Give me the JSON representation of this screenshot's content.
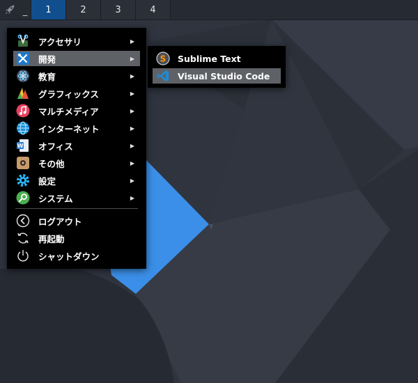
{
  "panel": {
    "launcher_icon": "rocket-icon",
    "separator": "_",
    "workspaces": [
      {
        "label": "1",
        "active": true
      },
      {
        "label": "2",
        "active": false
      },
      {
        "label": "3",
        "active": false
      },
      {
        "label": "4",
        "active": false
      }
    ]
  },
  "menu": {
    "categories": [
      {
        "label": "アクセサリ",
        "icon": "accessories-icon"
      },
      {
        "label": "開発",
        "icon": "development-icon",
        "highlighted": true
      },
      {
        "label": "教育",
        "icon": "education-icon"
      },
      {
        "label": "グラフィックス",
        "icon": "graphics-icon"
      },
      {
        "label": "マルチメディア",
        "icon": "multimedia-icon"
      },
      {
        "label": "インターネット",
        "icon": "internet-icon"
      },
      {
        "label": "オフィス",
        "icon": "office-icon"
      },
      {
        "label": "その他",
        "icon": "other-icon"
      },
      {
        "label": "設定",
        "icon": "settings-icon"
      },
      {
        "label": "システム",
        "icon": "system-icon"
      }
    ],
    "actions": [
      {
        "label": "ログアウト",
        "icon": "logout-icon"
      },
      {
        "label": "再起動",
        "icon": "restart-icon"
      },
      {
        "label": "シャットダウン",
        "icon": "power-icon"
      }
    ],
    "arrow": "▶"
  },
  "submenu": {
    "items": [
      {
        "label": "Sublime Text",
        "icon": "sublime-text-icon"
      },
      {
        "label": "Visual Studio Code",
        "icon": "vscode-icon",
        "highlighted": true
      }
    ]
  },
  "colors": {
    "accent_blue": "#3d8ee8",
    "panel_bg": "#262a33",
    "active_workspace": "#114e8e",
    "menu_bg": "#000000",
    "menu_highlight": "#5e6166"
  }
}
